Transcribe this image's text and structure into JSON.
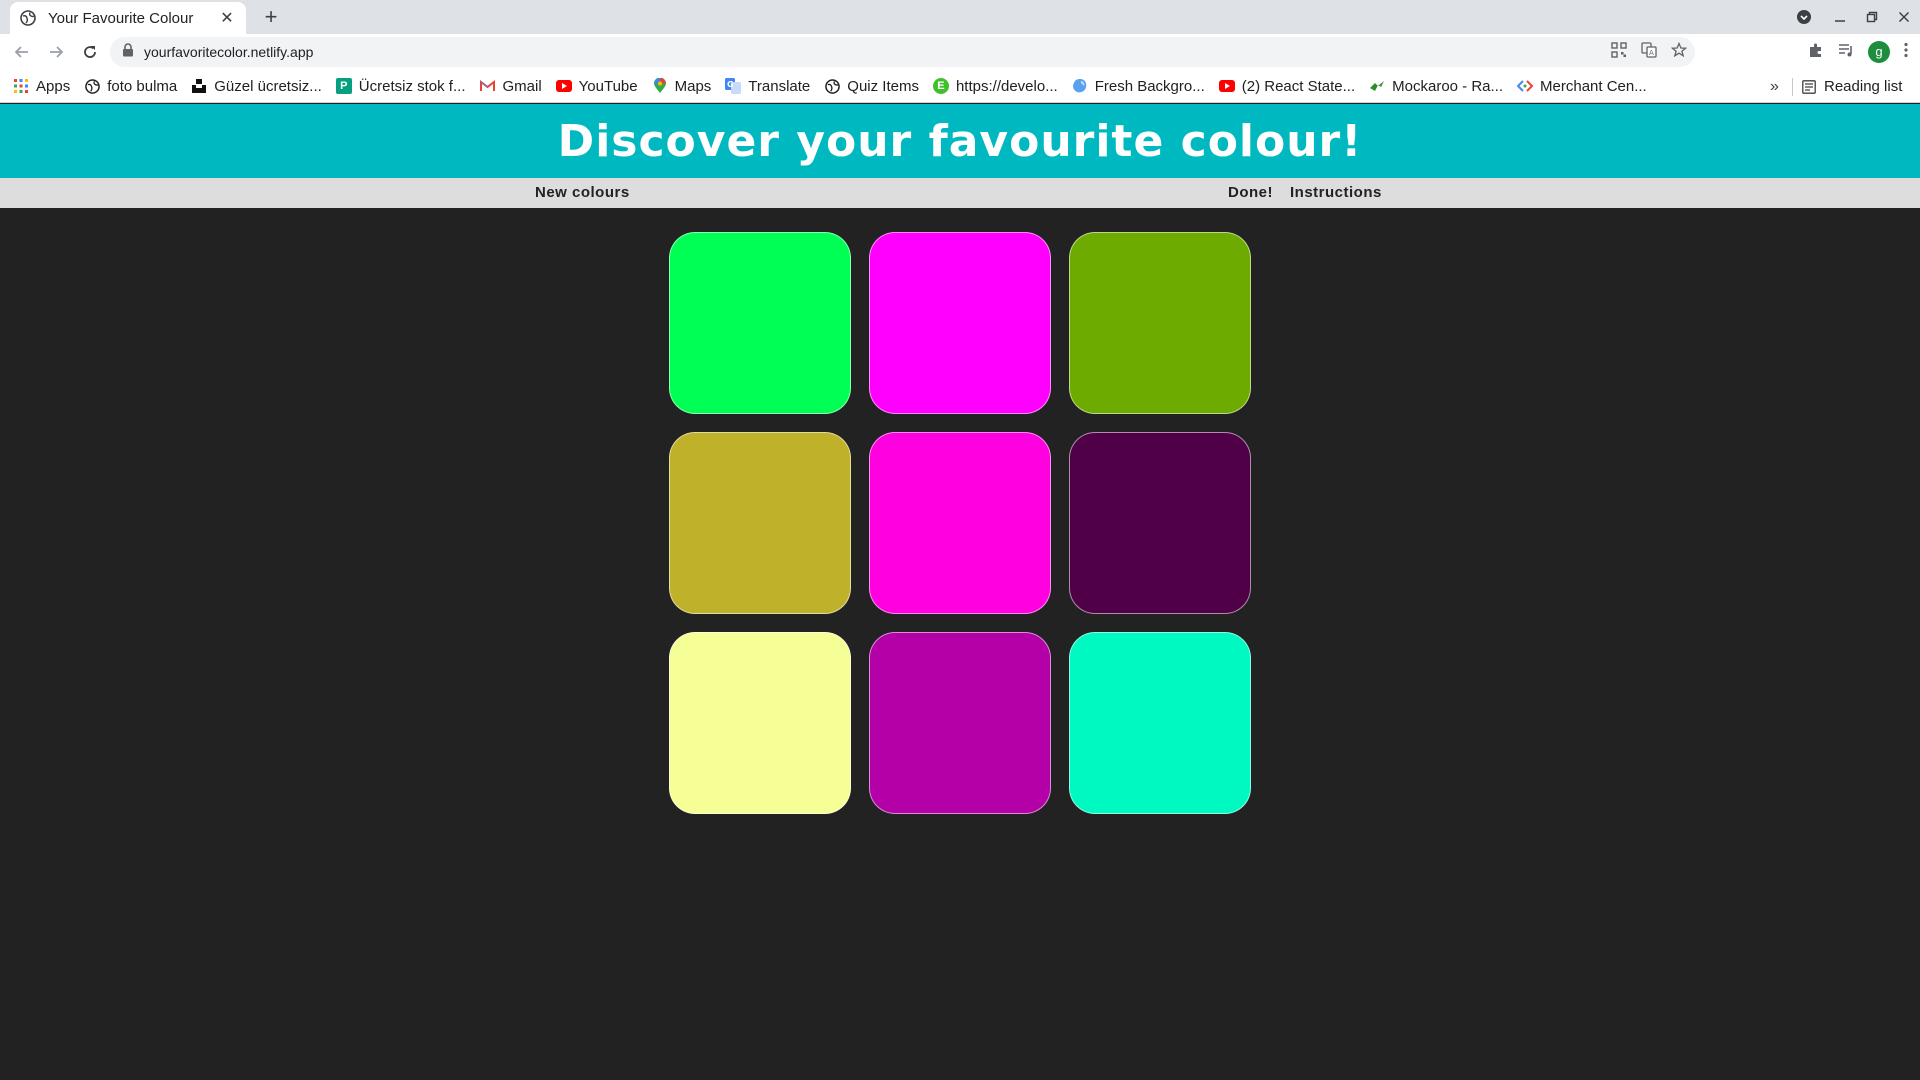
{
  "browser": {
    "tab_title": "Your Favourite Colour",
    "tab_close": "✕",
    "new_tab": "+",
    "url": "yourfavoritecolor.netlify.app",
    "profile_initial": "g"
  },
  "bookmarks": {
    "items": [
      {
        "label": "Apps",
        "icon": "apps-grid-icon"
      },
      {
        "label": "foto bulma",
        "icon": "globe-icon"
      },
      {
        "label": "Güzel ücretsiz...",
        "icon": "unsplash-icon"
      },
      {
        "label": "Ücretsiz stok f...",
        "icon": "pexels-icon"
      },
      {
        "label": "Gmail",
        "icon": "gmail-icon"
      },
      {
        "label": "YouTube",
        "icon": "youtube-icon"
      },
      {
        "label": "Maps",
        "icon": "maps-icon"
      },
      {
        "label": "Translate",
        "icon": "translate-icon"
      },
      {
        "label": "Quiz Items",
        "icon": "globe-icon"
      },
      {
        "label": "https://develo...",
        "icon": "e-icon"
      },
      {
        "label": "Fresh Backgro...",
        "icon": "blob-icon"
      },
      {
        "label": "(2) React State...",
        "icon": "youtube-icon"
      },
      {
        "label": "Mockaroo - Ra...",
        "icon": "mockaroo-icon"
      },
      {
        "label": "Merchant Cen...",
        "icon": "merchant-icon"
      }
    ],
    "more": "»",
    "reading_list": "Reading list"
  },
  "page": {
    "title": "Discover your favourite colour!",
    "menu": {
      "new_colours": "New colours",
      "done": "Done!",
      "instructions": "Instructions"
    },
    "swatches": [
      "#00ff55",
      "#ff00ff",
      "#6eab00",
      "#bfb129",
      "#ff00e0",
      "#4f0047",
      "#f6ff95",
      "#b300a7",
      "#00f9c0"
    ]
  },
  "colors": {
    "header_bg": "#00b9c0",
    "menu_bg": "#dddddd",
    "page_bg": "#222222"
  }
}
